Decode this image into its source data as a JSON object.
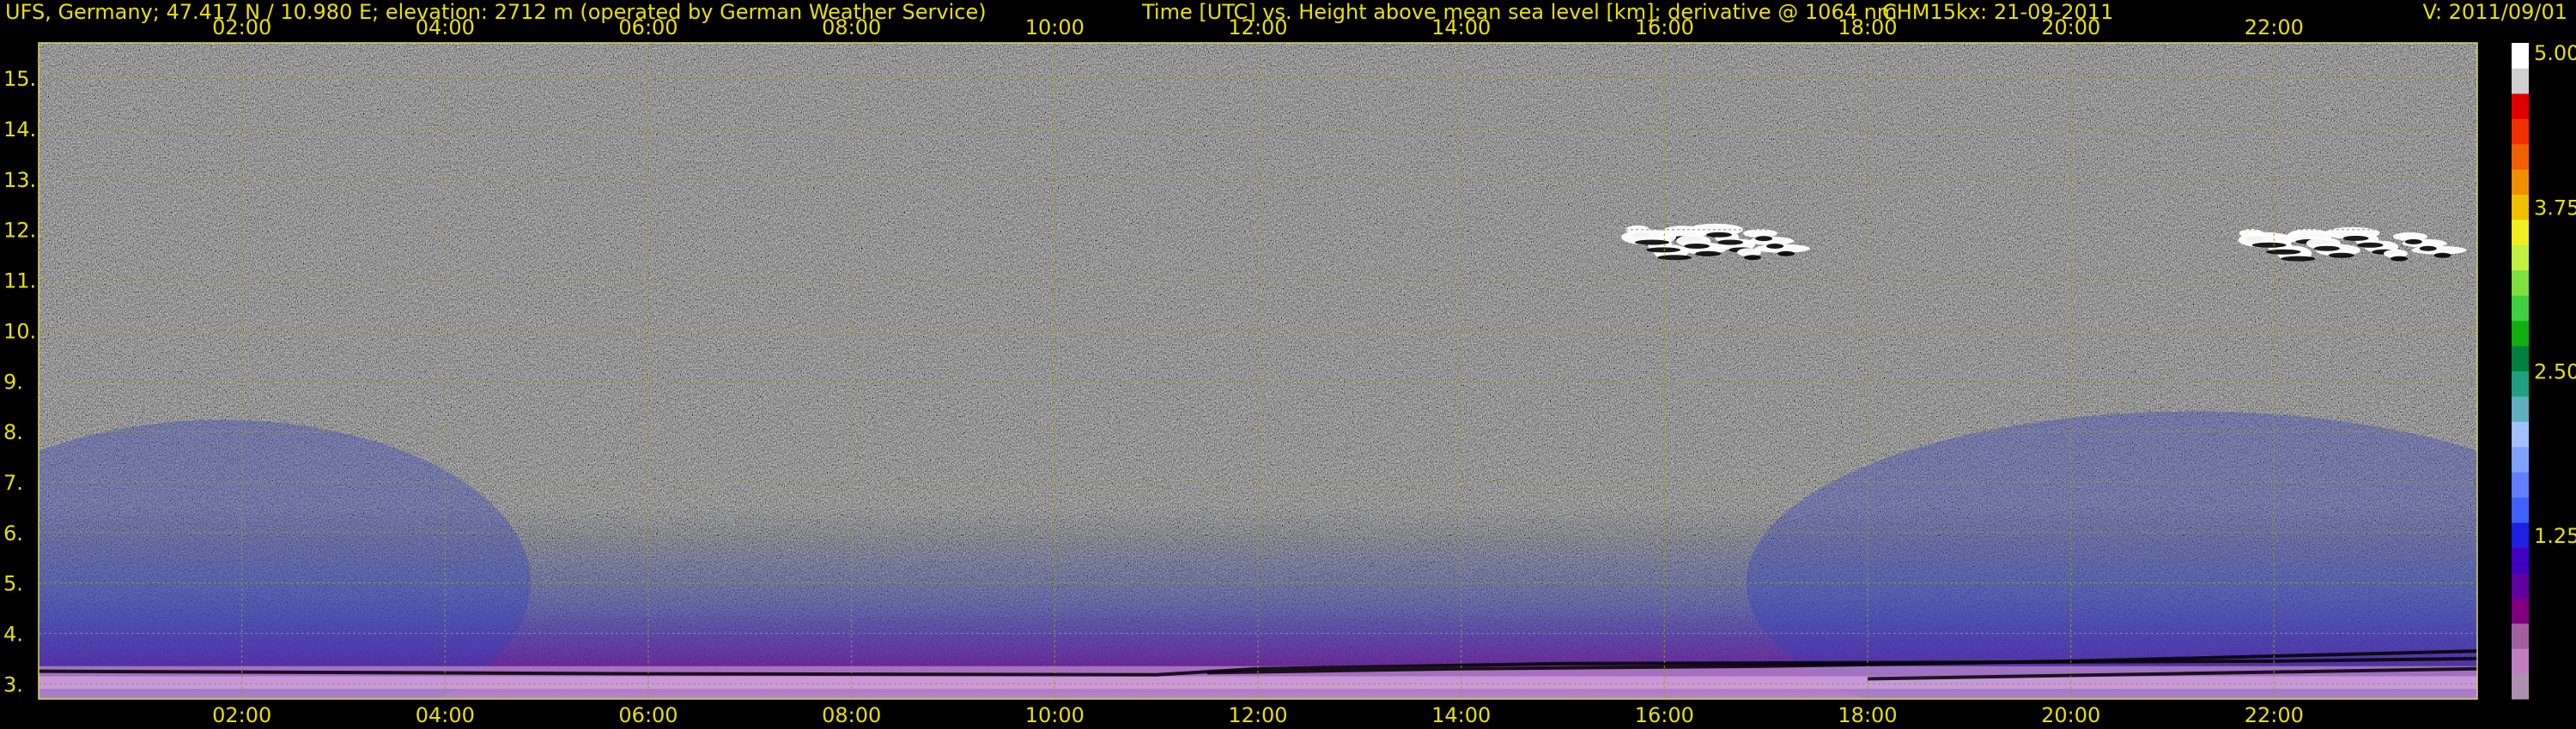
{
  "header": {
    "station": "UFS, Germany; 47.417 N / 10.980 E; elevation: 2712 m  (operated by German Weather Service)",
    "title": "Time [UTC] vs. Height above mean sea level [km]: derivative @ 1064 nm",
    "instrument": "CHM15kx: 21-09-2011",
    "version": "V: 2011/09/01"
  },
  "chart_data": {
    "type": "heatmap",
    "title": "Time [UTC] vs. Height above mean sea level [km]: derivative @ 1064 nm",
    "xlabel": "Time [UTC]",
    "ylabel": "Height above mean sea level [km]",
    "x_ticks": [
      "02:00",
      "04:00",
      "06:00",
      "08:00",
      "10:00",
      "12:00",
      "14:00",
      "16:00",
      "18:00",
      "20:00",
      "22:00"
    ],
    "x_tick_hours": [
      2,
      4,
      6,
      8,
      10,
      12,
      14,
      16,
      18,
      20,
      22
    ],
    "xlim": [
      0,
      24
    ],
    "y_ticks": [
      "3.",
      "4.",
      "5.",
      "6.",
      "7.",
      "8.",
      "9.",
      "10.",
      "11.",
      "12.",
      "13.",
      "14.",
      "15."
    ],
    "y_tick_values": [
      3,
      4,
      5,
      6,
      7,
      8,
      9,
      10,
      11,
      12,
      13,
      14,
      15
    ],
    "ylim": [
      2.7,
      15.7
    ],
    "grid": true,
    "colorbar": {
      "labels": [
        "5.00",
        "3.75",
        "2.50",
        "1.25"
      ],
      "values": [
        5.0,
        3.75,
        2.5,
        1.25
      ],
      "range": [
        0,
        5
      ],
      "colors": [
        "#b090b0",
        "#c080c0",
        "#a060a0",
        "#800080",
        "#6000a0",
        "#4000c0",
        "#2020e0",
        "#4060ff",
        "#6080ff",
        "#80a0ff",
        "#a0c0ff",
        "#60b0c0",
        "#20a080",
        "#008040",
        "#10b010",
        "#40d040",
        "#80e040",
        "#c0f040",
        "#f0f020",
        "#f0c000",
        "#f09000",
        "#f06000",
        "#f03000",
        "#e00000",
        "#d0d0d0",
        "#ffffff"
      ]
    },
    "features": [
      {
        "name": "boundary-layer aerosol",
        "x": [
          0,
          24
        ],
        "y": [
          2.7,
          6.5
        ]
      },
      {
        "name": "cirrus",
        "x": [
          15.6,
          17.3
        ],
        "y": [
          11.3,
          12.3
        ]
      },
      {
        "name": "cirrus",
        "x": [
          21.6,
          23.8
        ],
        "y": [
          11.3,
          12.2
        ]
      }
    ],
    "colors": {
      "text": "#e8e000",
      "grid": "#9a9a30",
      "background": "#000000"
    }
  }
}
